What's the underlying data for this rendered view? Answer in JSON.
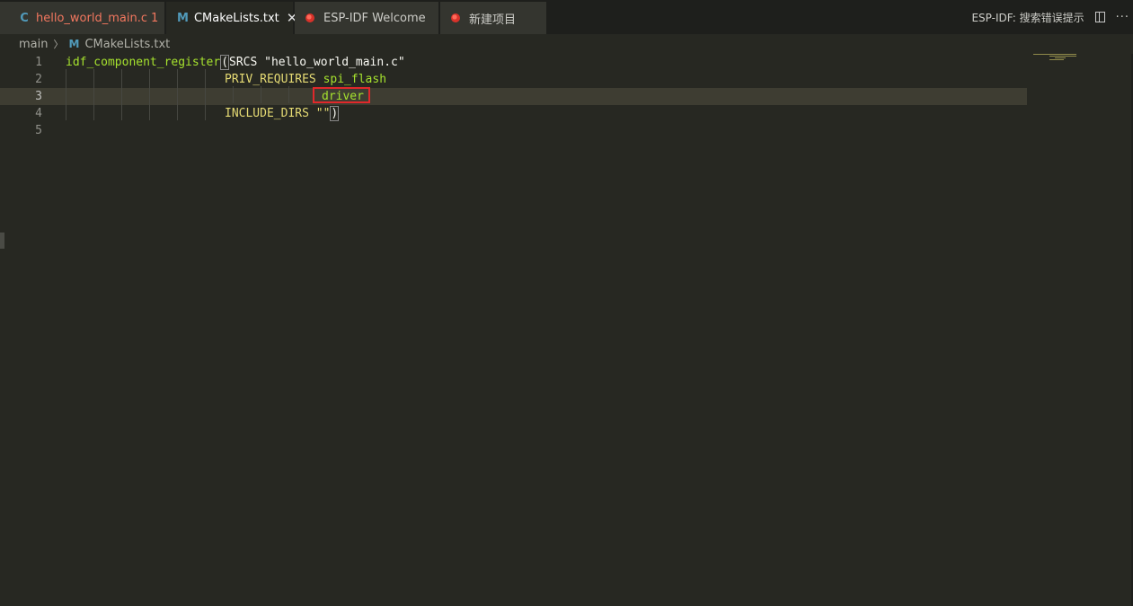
{
  "tabs": [
    {
      "icon": "C",
      "label": "hello_world_main.c",
      "badge": "1"
    },
    {
      "icon": "M",
      "label": "CMakeLists.txt",
      "close": "✕"
    },
    {
      "label": "ESP-IDF Welcome"
    },
    {
      "label": "新建项目"
    }
  ],
  "toolbar": {
    "command": "ESP-IDF:  搜索错误提示",
    "more": "···"
  },
  "breadcrumb": {
    "folder": "main",
    "sep": "〉",
    "file_icon": "M",
    "file": "CMakeLists.txt"
  },
  "editor": {
    "lines": [
      {
        "num": "1",
        "t1": "idf_component_register",
        "t2": "(",
        "t3": "SRCS \"hello_world_main.c\""
      },
      {
        "num": "2",
        "t1": "PRIV_REQUIRES ",
        "t2": "spi_flash"
      },
      {
        "num": "3",
        "t1": "driver"
      },
      {
        "num": "4",
        "t1": "INCLUDE_DIRS \"\"",
        "t2": ")"
      },
      {
        "num": "5"
      }
    ]
  },
  "colors": {
    "background": "#272822",
    "function": "#a6e22e",
    "string": "#e6db74",
    "highlight_box": "#e0282b"
  }
}
